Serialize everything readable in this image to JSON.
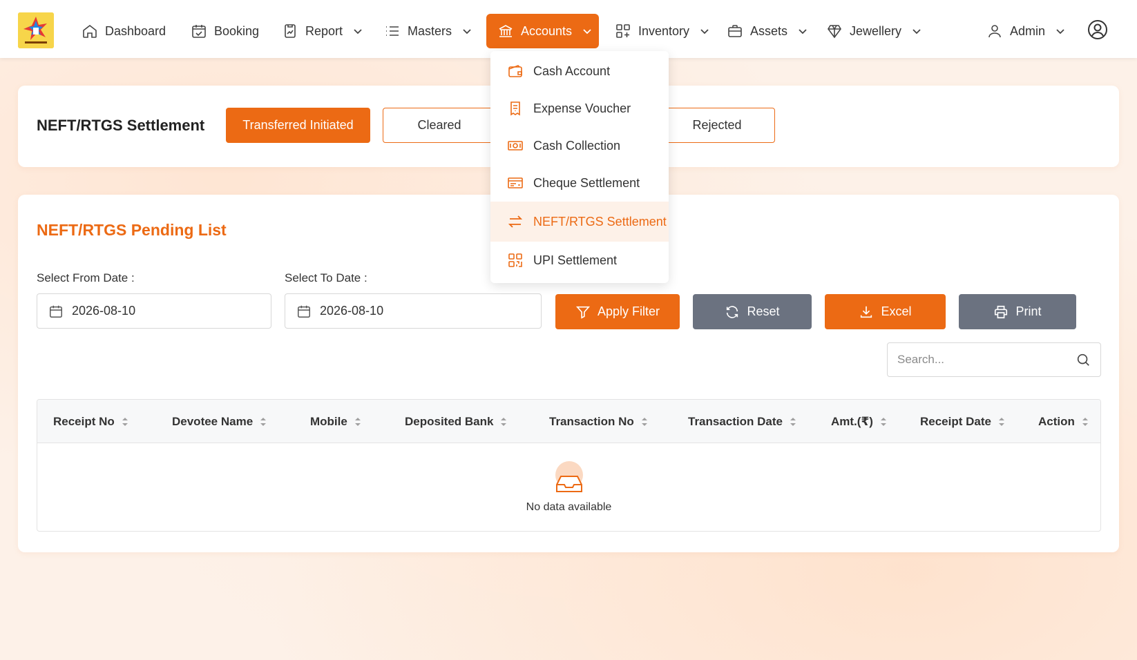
{
  "colors": {
    "accent": "#ec6a14",
    "gray_button": "#6b7280",
    "background": "#fdf1e8"
  },
  "navbar": {
    "items": [
      {
        "label": "Dashboard",
        "icon": "home-icon",
        "has_dropdown": false
      },
      {
        "label": "Booking",
        "icon": "calendar-check-icon",
        "has_dropdown": false
      },
      {
        "label": "Report",
        "icon": "report-icon",
        "has_dropdown": true
      },
      {
        "label": "Masters",
        "icon": "list-icon",
        "has_dropdown": true
      },
      {
        "label": "Accounts",
        "icon": "bank-icon",
        "has_dropdown": true,
        "active": true
      },
      {
        "label": "Inventory",
        "icon": "grid-icon",
        "has_dropdown": true
      },
      {
        "label": "Assets",
        "icon": "briefcase-icon",
        "has_dropdown": true
      },
      {
        "label": "Jewellery",
        "icon": "gem-icon",
        "has_dropdown": true
      }
    ],
    "user": {
      "label": "Admin",
      "icon": "user-icon"
    },
    "profile_icon": "user-circle-icon"
  },
  "accounts_menu": {
    "items": [
      {
        "label": "Cash Account",
        "icon": "wallet-icon"
      },
      {
        "label": "Expense Voucher",
        "icon": "receipt-icon"
      },
      {
        "label": "Cash Collection",
        "icon": "cash-icon"
      },
      {
        "label": "Cheque Settlement",
        "icon": "cheque-icon"
      },
      {
        "label": "NEFT/RTGS Settlement",
        "icon": "transfer-icon",
        "active": true
      },
      {
        "label": "UPI Settlement",
        "icon": "qr-icon"
      }
    ]
  },
  "settlement": {
    "title": "NEFT/RTGS Settlement",
    "tabs": [
      {
        "label": "Transferred Initiated",
        "active": true
      },
      {
        "label": "Cleared",
        "active": false
      },
      {
        "label": "Rejected",
        "active": false
      }
    ]
  },
  "pending": {
    "title": "NEFT/RTGS Pending List",
    "from_label": "Select From Date :",
    "from_value": "2026-08-10",
    "to_label": "Select To Date :",
    "to_value": "2026-08-10",
    "buttons": {
      "apply": "Apply Filter",
      "reset": "Reset",
      "excel": "Excel",
      "print": "Print"
    },
    "search_placeholder": "Search..."
  },
  "table": {
    "columns": [
      "Receipt No",
      "Devotee Name",
      "Mobile",
      "Deposited Bank",
      "Transaction No",
      "Transaction Date",
      "Amt.(₹)",
      "Receipt Date",
      "Action"
    ],
    "rows": [],
    "empty_text": "No data available"
  }
}
